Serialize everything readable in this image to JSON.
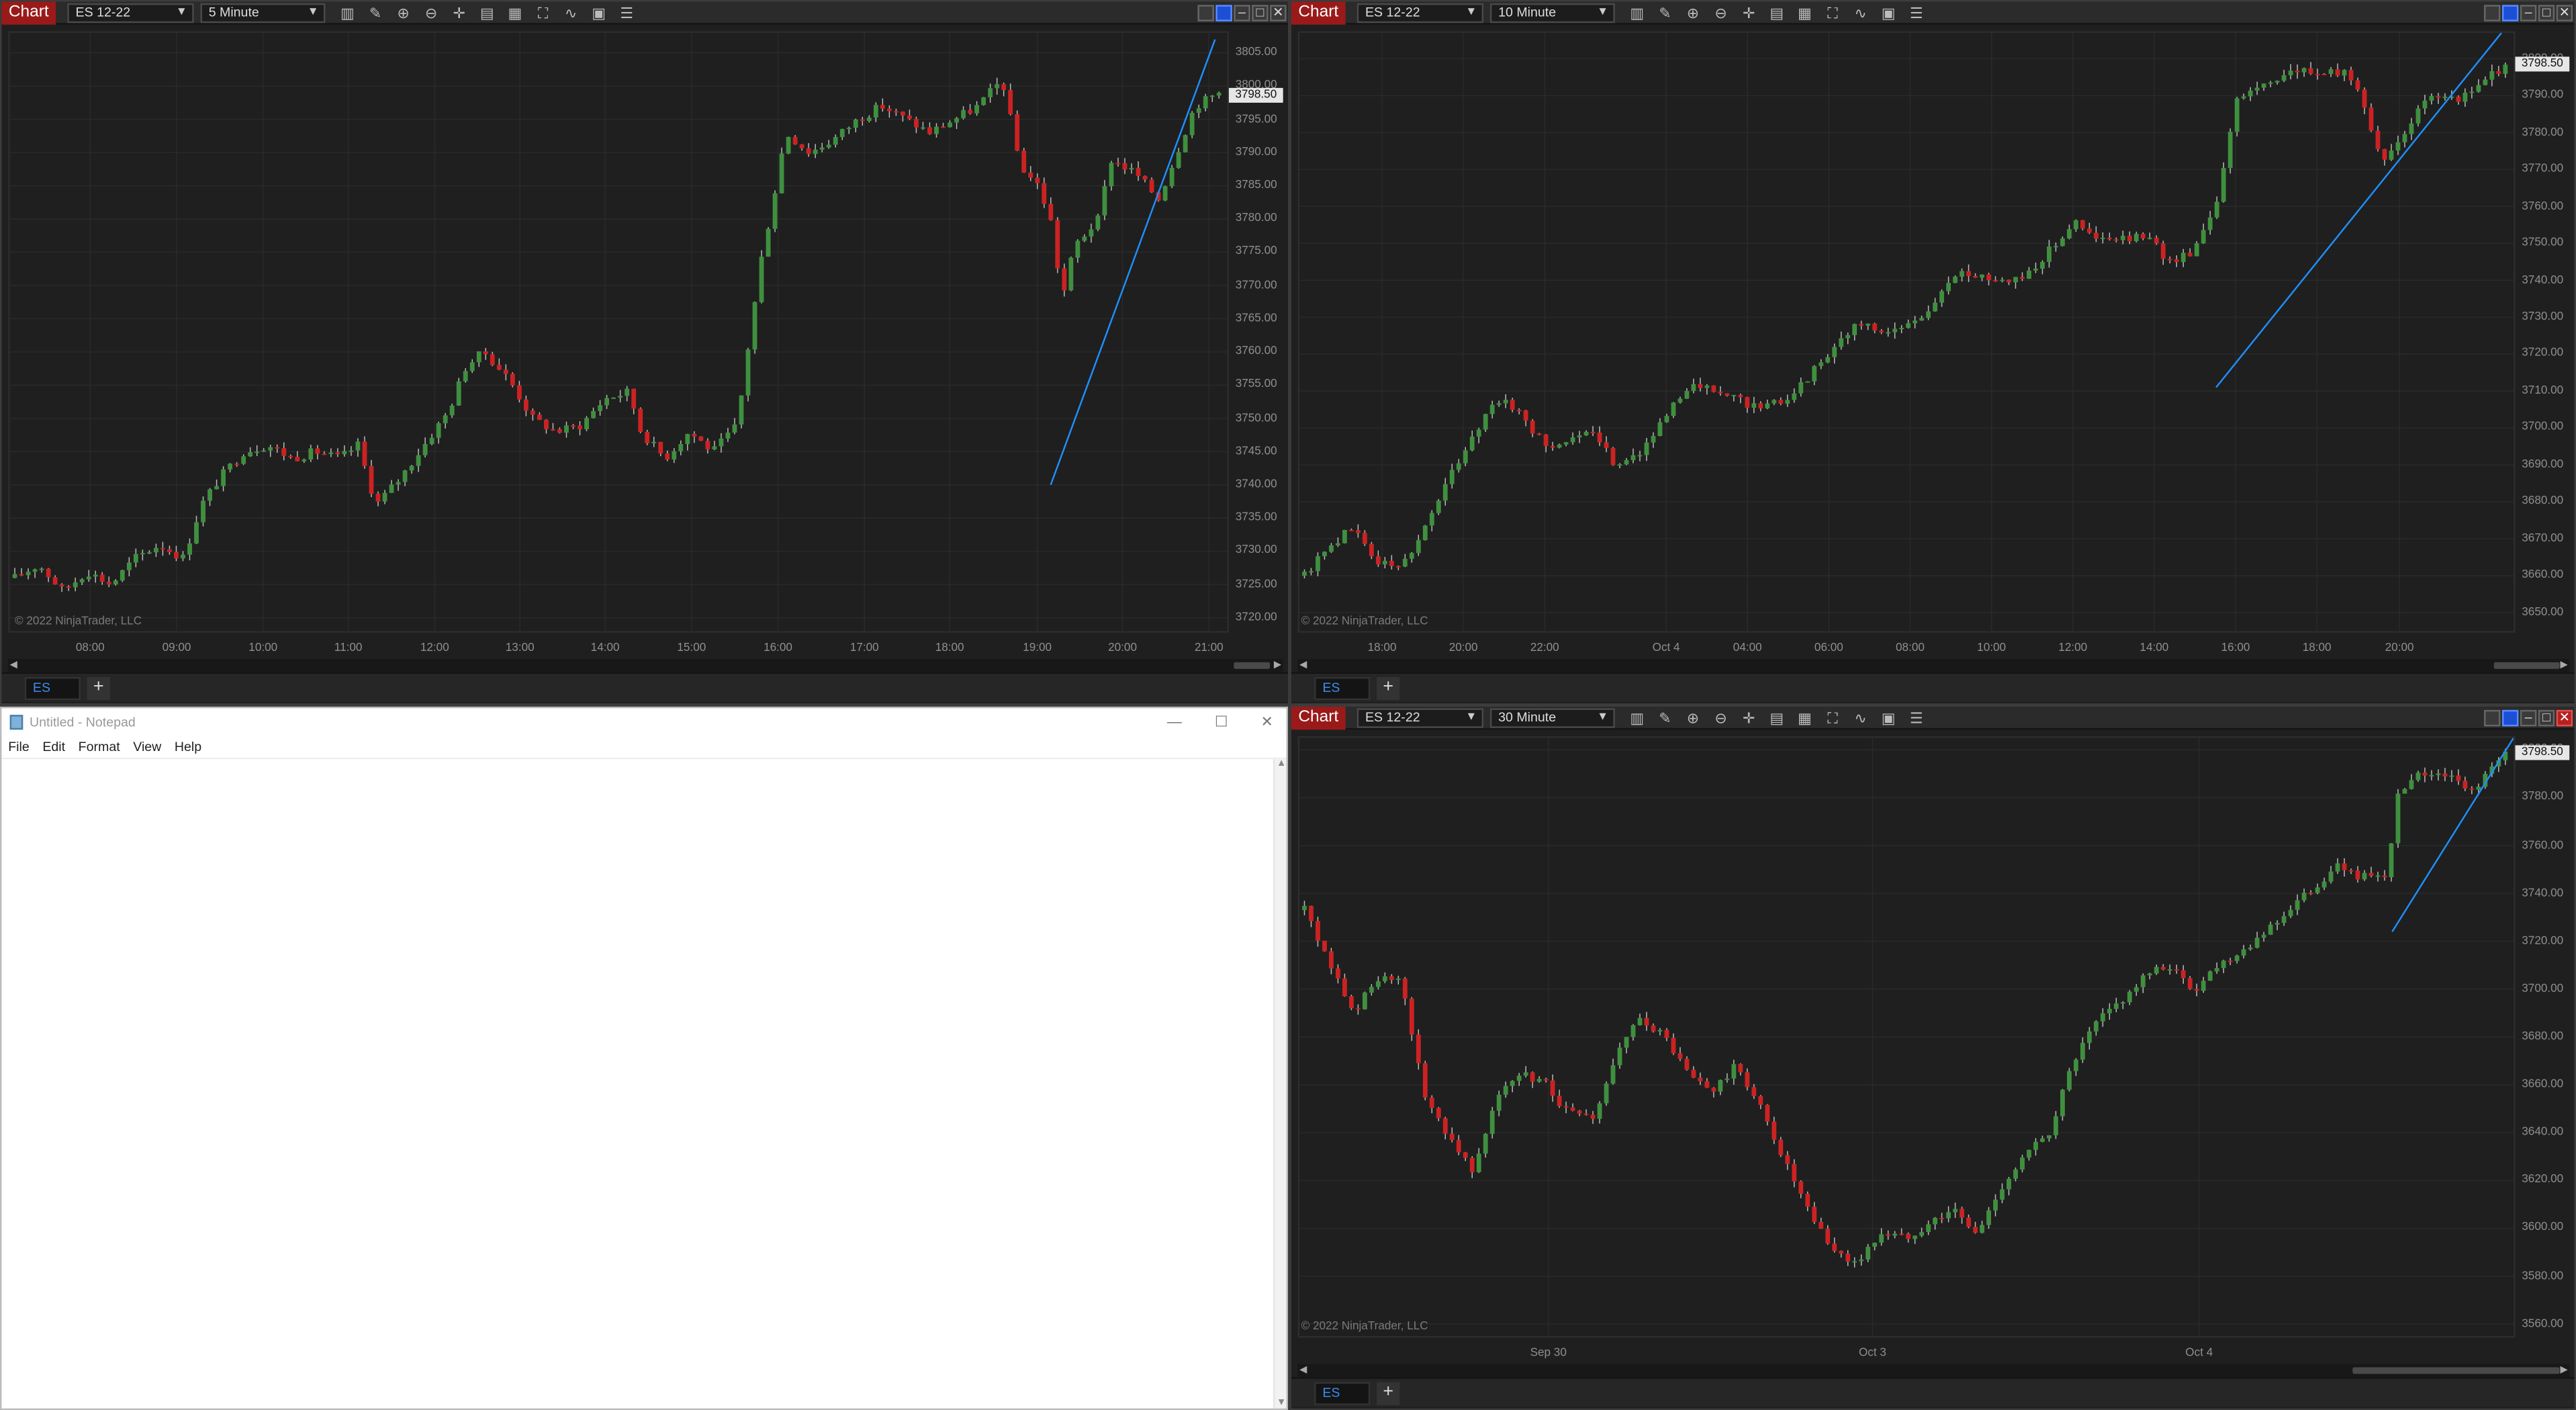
{
  "charts": [
    {
      "id": "c1",
      "tag": "Chart",
      "instrument": "ES 12-22",
      "interval": "5 Minute",
      "tab": "ES",
      "copyright": "© 2022 NinjaTrader, LLC",
      "current_price": "3798.50",
      "price_value": 3798.5,
      "y_ticks": [
        "3805.00",
        "3800.00",
        "3795.00",
        "3790.00",
        "3785.00",
        "3780.00",
        "3775.00",
        "3770.00",
        "3765.00",
        "3760.00",
        "3755.00",
        "3750.00",
        "3745.00",
        "3740.00",
        "3735.00",
        "3730.00",
        "3725.00",
        "3720.00"
      ],
      "ylim": [
        3718,
        3808
      ],
      "x_ticks": [
        "08:00",
        "09:00",
        "10:00",
        "11:00",
        "12:00",
        "13:00",
        "14:00",
        "15:00",
        "16:00",
        "17:00",
        "18:00",
        "19:00",
        "20:00",
        "21:00"
      ],
      "x_tick_pos": [
        0.066,
        0.137,
        0.208,
        0.278,
        0.349,
        0.419,
        0.489,
        0.56,
        0.631,
        0.702,
        0.772,
        0.844,
        0.914,
        0.985
      ],
      "close_path": [
        [
          0,
          3726
        ],
        [
          0.02,
          3728
        ],
        [
          0.04,
          3724
        ],
        [
          0.06,
          3727
        ],
        [
          0.08,
          3725
        ],
        [
          0.1,
          3729
        ],
        [
          0.12,
          3731
        ],
        [
          0.14,
          3729
        ],
        [
          0.155,
          3737
        ],
        [
          0.17,
          3741
        ],
        [
          0.19,
          3745
        ],
        [
          0.21,
          3746
        ],
        [
          0.23,
          3744
        ],
        [
          0.25,
          3745
        ],
        [
          0.27,
          3744
        ],
        [
          0.285,
          3746
        ],
        [
          0.3,
          3737
        ],
        [
          0.32,
          3741
        ],
        [
          0.34,
          3746
        ],
        [
          0.36,
          3751
        ],
        [
          0.375,
          3758
        ],
        [
          0.39,
          3760
        ],
        [
          0.41,
          3756
        ],
        [
          0.43,
          3750
        ],
        [
          0.45,
          3748
        ],
        [
          0.47,
          3749
        ],
        [
          0.49,
          3753
        ],
        [
          0.51,
          3754
        ],
        [
          0.52,
          3748
        ],
        [
          0.54,
          3744
        ],
        [
          0.56,
          3748
        ],
        [
          0.58,
          3745
        ],
        [
          0.6,
          3749
        ],
        [
          0.61,
          3762
        ],
        [
          0.62,
          3774
        ],
        [
          0.63,
          3783
        ],
        [
          0.64,
          3793
        ],
        [
          0.66,
          3790
        ],
        [
          0.68,
          3792
        ],
        [
          0.7,
          3795
        ],
        [
          0.72,
          3797
        ],
        [
          0.74,
          3795
        ],
        [
          0.76,
          3793
        ],
        [
          0.78,
          3795
        ],
        [
          0.8,
          3797
        ],
        [
          0.82,
          3801
        ],
        [
          0.835,
          3788
        ],
        [
          0.85,
          3785
        ],
        [
          0.86,
          3780
        ],
        [
          0.87,
          3768
        ],
        [
          0.88,
          3776
        ],
        [
          0.9,
          3780
        ],
        [
          0.91,
          3789
        ],
        [
          0.93,
          3787
        ],
        [
          0.95,
          3783
        ],
        [
          0.965,
          3790
        ],
        [
          0.98,
          3797
        ],
        [
          1,
          3799
        ]
      ],
      "trendline": [
        [
          0.855,
          3740
        ],
        [
          0.99,
          3807
        ]
      ]
    },
    {
      "id": "c2",
      "tag": "Chart",
      "instrument": "ES 12-22",
      "interval": "10 Minute",
      "tab": "ES",
      "copyright": "© 2022 NinjaTrader, LLC",
      "current_price": "3798.50",
      "price_value": 3798.5,
      "y_ticks": [
        "3800.00",
        "3790.00",
        "3780.00",
        "3770.00",
        "3760.00",
        "3750.00",
        "3740.00",
        "3730.00",
        "3720.00",
        "3710.00",
        "3700.00",
        "3690.00",
        "3680.00",
        "3670.00",
        "3660.00",
        "3650.00"
      ],
      "ylim": [
        3645,
        3807
      ],
      "x_ticks": [
        "18:00",
        "20:00",
        "22:00",
        "Oct 4",
        "04:00",
        "06:00",
        "08:00",
        "10:00",
        "12:00",
        "14:00",
        "16:00",
        "18:00",
        "20:00"
      ],
      "x_tick_pos": [
        0.068,
        0.135,
        0.202,
        0.302,
        0.369,
        0.436,
        0.503,
        0.57,
        0.637,
        0.704,
        0.771,
        0.838,
        0.906
      ],
      "close_path": [
        [
          0,
          3660
        ],
        [
          0.02,
          3668
        ],
        [
          0.04,
          3673
        ],
        [
          0.06,
          3664
        ],
        [
          0.08,
          3662
        ],
        [
          0.1,
          3673
        ],
        [
          0.12,
          3686
        ],
        [
          0.14,
          3698
        ],
        [
          0.16,
          3708
        ],
        [
          0.18,
          3704
        ],
        [
          0.2,
          3695
        ],
        [
          0.22,
          3697
        ],
        [
          0.24,
          3698
        ],
        [
          0.26,
          3690
        ],
        [
          0.28,
          3694
        ],
        [
          0.3,
          3702
        ],
        [
          0.32,
          3712
        ],
        [
          0.34,
          3710
        ],
        [
          0.36,
          3708
        ],
        [
          0.38,
          3705
        ],
        [
          0.4,
          3708
        ],
        [
          0.42,
          3714
        ],
        [
          0.44,
          3722
        ],
        [
          0.46,
          3728
        ],
        [
          0.48,
          3726
        ],
        [
          0.5,
          3727
        ],
        [
          0.52,
          3732
        ],
        [
          0.54,
          3741
        ],
        [
          0.56,
          3742
        ],
        [
          0.58,
          3740
        ],
        [
          0.6,
          3741
        ],
        [
          0.62,
          3748
        ],
        [
          0.64,
          3756
        ],
        [
          0.66,
          3751
        ],
        [
          0.68,
          3751
        ],
        [
          0.7,
          3752
        ],
        [
          0.72,
          3745
        ],
        [
          0.74,
          3748
        ],
        [
          0.76,
          3762
        ],
        [
          0.775,
          3788
        ],
        [
          0.79,
          3792
        ],
        [
          0.81,
          3795
        ],
        [
          0.83,
          3797
        ],
        [
          0.85,
          3796
        ],
        [
          0.87,
          3796
        ],
        [
          0.88,
          3790
        ],
        [
          0.89,
          3780
        ],
        [
          0.9,
          3771
        ],
        [
          0.92,
          3783
        ],
        [
          0.94,
          3790
        ],
        [
          0.96,
          3788
        ],
        [
          0.98,
          3794
        ],
        [
          1,
          3798
        ]
      ],
      "trendline": [
        [
          0.755,
          3711
        ],
        [
          0.99,
          3807
        ]
      ]
    },
    {
      "id": "c3",
      "tag": "Chart",
      "instrument": "ES 12-22",
      "interval": "30 Minute",
      "tab": "ES",
      "copyright": "© 2022 NinjaTrader, LLC",
      "current_price": "3798.50",
      "price_value": 3798.5,
      "y_ticks": [
        "3800.00",
        "3780.00",
        "3760.00",
        "3740.00",
        "3720.00",
        "3700.00",
        "3680.00",
        "3660.00",
        "3640.00",
        "3620.00",
        "3600.00",
        "3580.00",
        "3560.00"
      ],
      "ylim": [
        3555,
        3805
      ],
      "x_ticks": [
        "Sep 30",
        "Oct 3",
        "Oct 4"
      ],
      "x_tick_pos": [
        0.205,
        0.472,
        0.741
      ],
      "close_path": [
        [
          0,
          3733
        ],
        [
          0.02,
          3712
        ],
        [
          0.04,
          3690
        ],
        [
          0.06,
          3704
        ],
        [
          0.08,
          3703
        ],
        [
          0.1,
          3656
        ],
        [
          0.12,
          3639
        ],
        [
          0.14,
          3625
        ],
        [
          0.16,
          3655
        ],
        [
          0.18,
          3664
        ],
        [
          0.2,
          3661
        ],
        [
          0.22,
          3648
        ],
        [
          0.24,
          3645
        ],
        [
          0.26,
          3672
        ],
        [
          0.28,
          3688
        ],
        [
          0.3,
          3680
        ],
        [
          0.32,
          3664
        ],
        [
          0.34,
          3657
        ],
        [
          0.36,
          3668
        ],
        [
          0.38,
          3650
        ],
        [
          0.4,
          3628
        ],
        [
          0.42,
          3606
        ],
        [
          0.44,
          3591
        ],
        [
          0.46,
          3585
        ],
        [
          0.48,
          3598
        ],
        [
          0.5,
          3596
        ],
        [
          0.52,
          3602
        ],
        [
          0.54,
          3608
        ],
        [
          0.56,
          3597
        ],
        [
          0.58,
          3617
        ],
        [
          0.6,
          3630
        ],
        [
          0.62,
          3640
        ],
        [
          0.64,
          3669
        ],
        [
          0.66,
          3686
        ],
        [
          0.68,
          3695
        ],
        [
          0.7,
          3705
        ],
        [
          0.72,
          3710
        ],
        [
          0.74,
          3699
        ],
        [
          0.76,
          3710
        ],
        [
          0.78,
          3716
        ],
        [
          0.8,
          3724
        ],
        [
          0.82,
          3733
        ],
        [
          0.84,
          3742
        ],
        [
          0.86,
          3751
        ],
        [
          0.88,
          3747
        ],
        [
          0.9,
          3745
        ],
        [
          0.91,
          3780
        ],
        [
          0.93,
          3790
        ],
        [
          0.95,
          3790
        ],
        [
          0.97,
          3782
        ],
        [
          1,
          3798
        ]
      ],
      "trendline": [
        [
          0.9,
          3724
        ],
        [
          1.0,
          3805
        ]
      ]
    }
  ],
  "notepad": {
    "title": "Untitled - Notepad",
    "menu": [
      "File",
      "Edit",
      "Format",
      "View",
      "Help"
    ],
    "content": ""
  },
  "colors": {
    "up": "#3f8f3f",
    "down": "#cc2222",
    "trendline": "#1e90ff",
    "grid": "#2a2a2a",
    "bg": "#1f1f1f"
  }
}
